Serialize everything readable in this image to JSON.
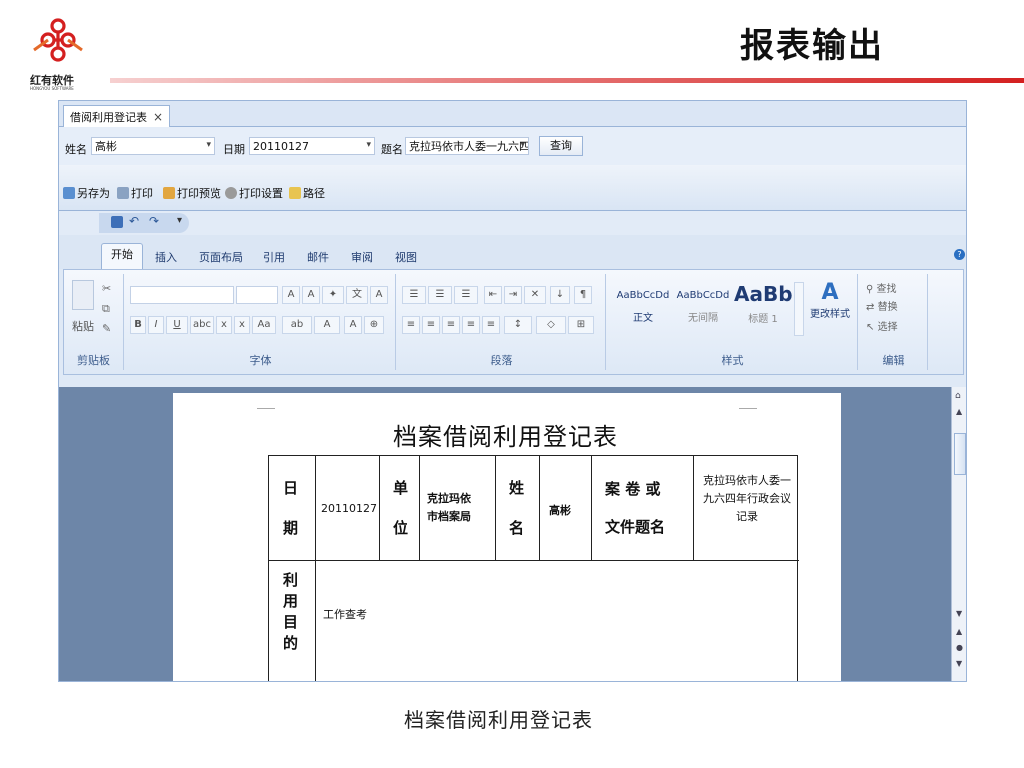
{
  "slide": {
    "company": "红有软件",
    "company_sub": "HONGYOU SOFTWARE",
    "title": "报表输出",
    "caption": "档案借阅利用登记表"
  },
  "app": {
    "tab_label": "借阅利用登记表",
    "tab_close": "×",
    "filter": {
      "name_label": "姓名",
      "name_value": "高彬",
      "date_label": "日期",
      "date_value": "20110127",
      "subject_label": "题名",
      "subject_value": "克拉玛依市人委一九六四",
      "query_button": "查询"
    },
    "toolbar": {
      "save_as": "另存为",
      "print": "打印",
      "print_preview": "打印预览",
      "print_settings": "打印设置",
      "path": "路径"
    },
    "ribbon_tabs": [
      "开始",
      "插入",
      "页面布局",
      "引用",
      "邮件",
      "审阅",
      "视图"
    ],
    "ribbon_groups": {
      "clipboard": "剪贴板",
      "paste": "粘贴",
      "font": "字体",
      "paragraph": "段落",
      "styles": "样式",
      "editing": "编辑",
      "change_styles": "更改样式",
      "find": "查找",
      "replace": "替换",
      "select": "选择"
    },
    "styles": [
      {
        "preview": "AaBbCcDd",
        "name": "正文"
      },
      {
        "preview": "AaBbCcDd",
        "name": "无间隔"
      },
      {
        "preview": "AaBb",
        "name": "标题 1"
      }
    ]
  },
  "document": {
    "title": "档案借阅利用登记表",
    "rows": {
      "date_label": "日\n期",
      "date_value": "20110127",
      "unit_label": "单\n位",
      "unit_value": "克拉玛依\n市档案局",
      "name_label": "姓\n名",
      "name_value": "高彬",
      "file_label": "案 卷 或\n文件题名",
      "file_value": "克拉玛依市人委一\n九六四年行政会议\n记录",
      "purpose_label": "利\n用\n目\n的",
      "purpose_value": "工作查考"
    }
  },
  "colors": {
    "accent": "#d42020",
    "ribbon_blue": "#dbe6f4",
    "canvas": "#6d86a8"
  }
}
